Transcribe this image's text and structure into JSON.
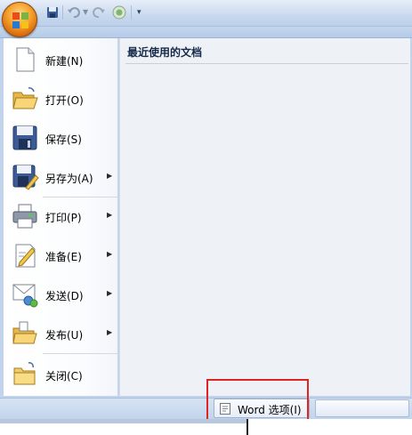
{
  "menu": {
    "items": [
      {
        "label": "新建(N)",
        "icon": "new-document-icon",
        "submenu": false
      },
      {
        "label": "打开(O)",
        "icon": "open-folder-icon",
        "submenu": false
      },
      {
        "label": "保存(S)",
        "icon": "save-disk-icon",
        "submenu": false
      },
      {
        "label": "另存为(A)",
        "icon": "save-as-icon",
        "submenu": true
      },
      {
        "label": "打印(P)",
        "icon": "printer-icon",
        "submenu": true
      },
      {
        "label": "准备(E)",
        "icon": "prepare-icon",
        "submenu": true
      },
      {
        "label": "发送(D)",
        "icon": "send-icon",
        "submenu": true
      },
      {
        "label": "发布(U)",
        "icon": "publish-icon",
        "submenu": true
      },
      {
        "label": "关闭(C)",
        "icon": "close-folder-icon",
        "submenu": false
      }
    ],
    "recent_title": "最近使用的文档"
  },
  "bottom": {
    "word_options_label": "Word 选项(I)"
  },
  "colors": {
    "highlight": "#e02424",
    "office_orange": "#f6a431"
  }
}
